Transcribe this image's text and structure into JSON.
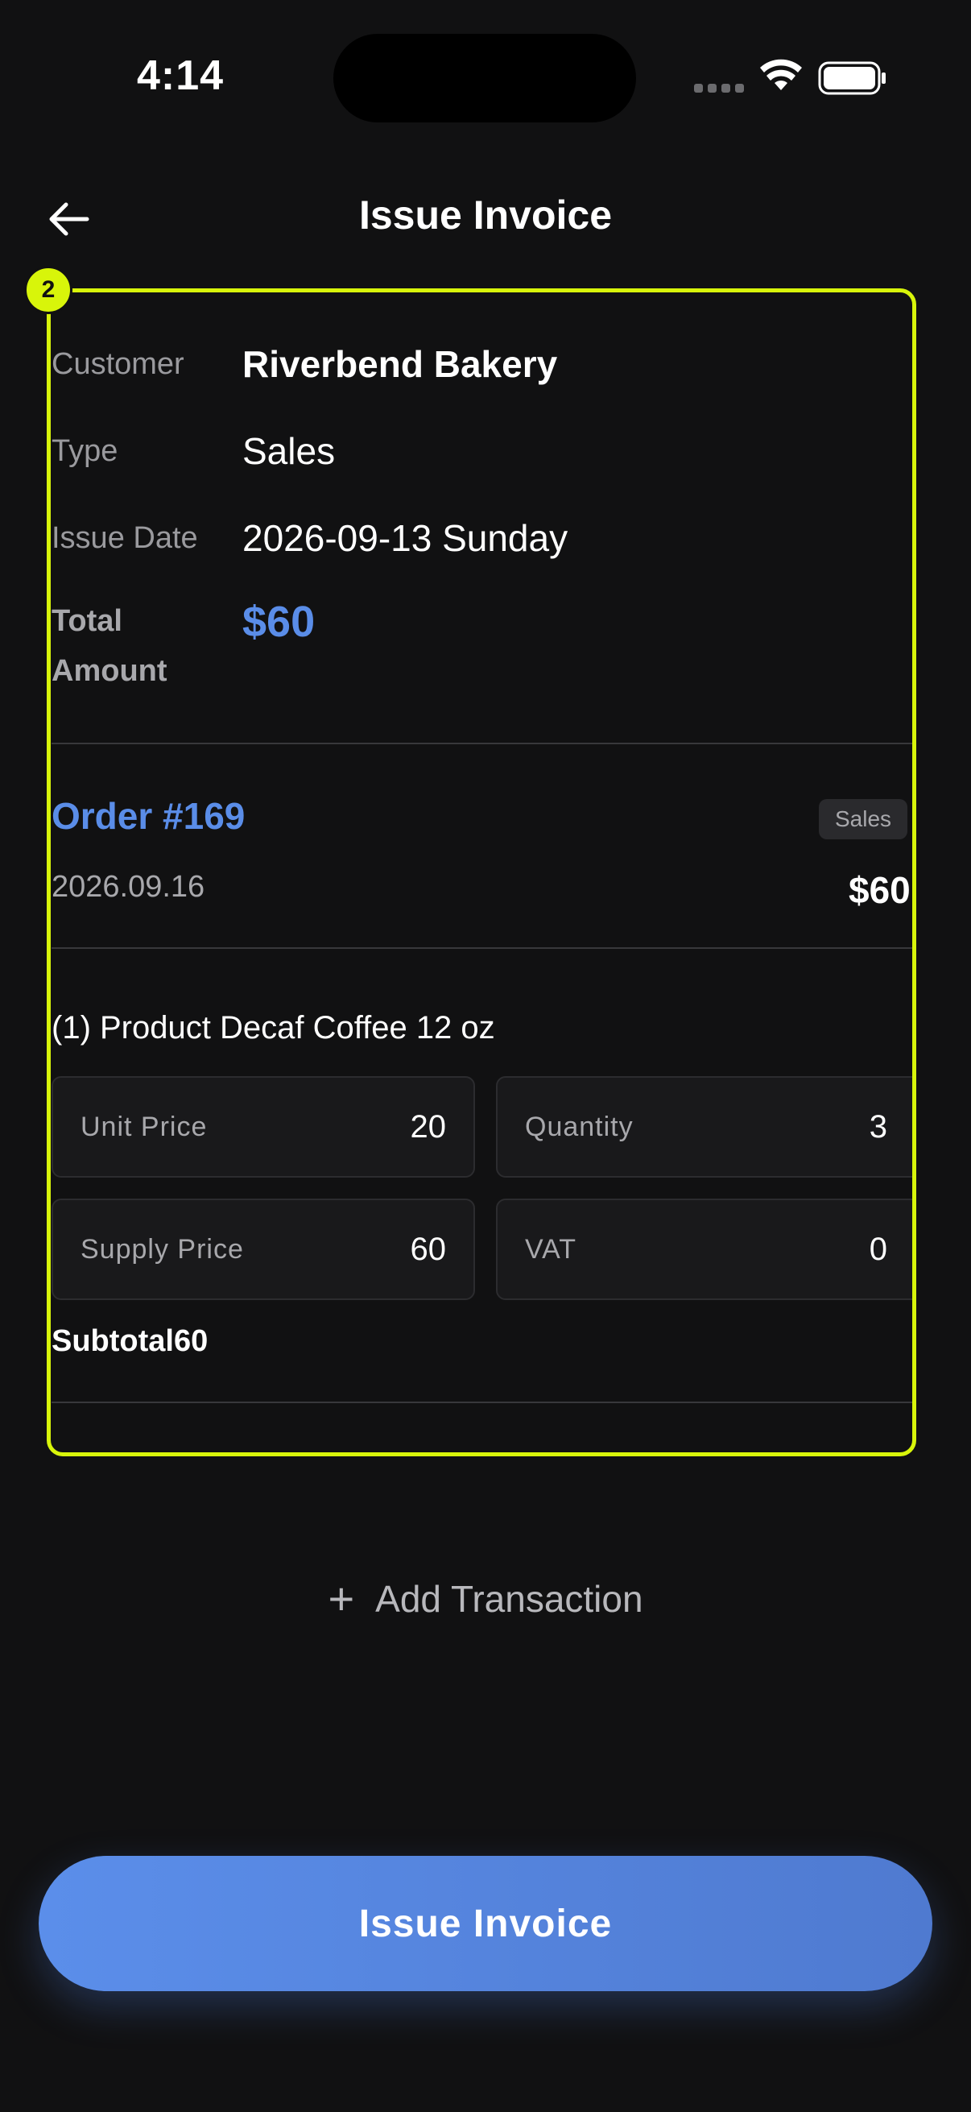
{
  "status_bar": {
    "time": "4:14"
  },
  "header": {
    "title": "Issue Invoice",
    "back_icon": "arrow-left-icon"
  },
  "highlight": {
    "badge": "2",
    "color": "#d8f50a"
  },
  "invoice": {
    "customer_label": "Customer",
    "customer_value": "Riverbend Bakery",
    "type_label": "Type",
    "type_value": "Sales",
    "issue_date_label": "Issue Date",
    "issue_date_value": "2026-09-13 Sunday",
    "total_label": "Total Amount",
    "total_value": "$60"
  },
  "order": {
    "title": "Order #169",
    "badge": "Sales",
    "date": "2026.09.16",
    "amount": "$60"
  },
  "product": {
    "title": "(1) Product Decaf Coffee 12 oz",
    "unit_price_label": "Unit Price",
    "unit_price_value": "20",
    "quantity_label": "Quantity",
    "quantity_value": "3",
    "supply_price_label": "Supply Price",
    "supply_price_value": "60",
    "vat_label": "VAT",
    "vat_value": "0",
    "subtotal": "Subtotal60"
  },
  "actions": {
    "add_transaction_label": "Add Transaction",
    "add_icon": "plus-icon",
    "issue_button_label": "Issue Invoice"
  },
  "colors": {
    "background": "#111112",
    "accent": "#5a8de8",
    "highlight": "#d8f50a"
  }
}
